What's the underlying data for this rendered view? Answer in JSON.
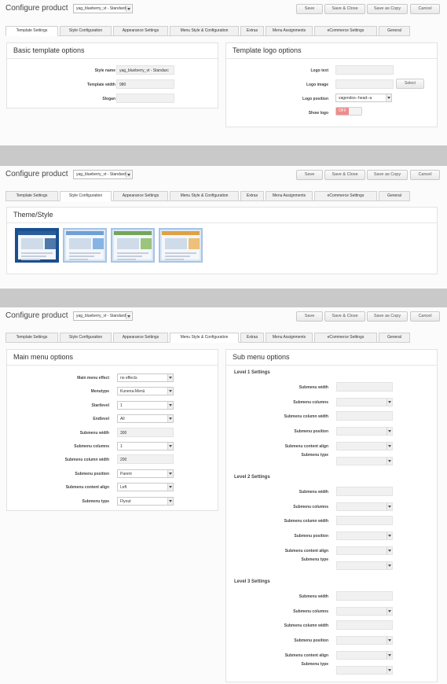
{
  "colors": {
    "separator": "#c9c9c9",
    "toggle_off": "#ef8c8c",
    "active_theme_border": "#1a4f8f"
  },
  "toolbar": {
    "title": "Configure product",
    "product_select": "yag_blueberry_vt - Standard",
    "save": "Save",
    "save_close": "Save & Close",
    "save_copy": "Save as Copy",
    "cancel": "Cancel"
  },
  "tabs": [
    "Template Settings",
    "Style Configuration",
    "Appearance Settings",
    "Menu Style & Configuration",
    "Extras",
    "Menu Assignments",
    "eCommerce Settings",
    "General"
  ],
  "panel1": {
    "basic": {
      "title": "Basic template options",
      "style_name_label": "Style name",
      "style_name_value": "yag_blueberry_vt - Standarc",
      "template_width_label": "Template width",
      "template_width_value": "980",
      "slogan_label": "Slogan"
    },
    "logo": {
      "title": "Template logo options",
      "logo_text_label": "Logo text",
      "logo_image_label": "Logo image",
      "select_button": "Select",
      "logo_position_label": "Logo position",
      "logo_position_value": "vagendos--head--a",
      "show_logo_label": "Show logo",
      "show_logo_value": "OFF"
    }
  },
  "panel2": {
    "title": "Theme/Style",
    "themes": [
      {
        "name": "theme-blue",
        "bar": "#2c5d9b",
        "accent": "#4f78ad"
      },
      {
        "name": "theme-sky",
        "bar": "#6e9fd6",
        "accent": "#86b4e4"
      },
      {
        "name": "theme-green",
        "bar": "#74a55a",
        "accent": "#9cc47d"
      },
      {
        "name": "theme-orange",
        "bar": "#e0a043",
        "accent": "#eec07a"
      }
    ]
  },
  "panel3": {
    "main": {
      "title": "Main menu options",
      "fields": [
        {
          "label": "Main menu effect",
          "value": "no effects",
          "kind": "select"
        },
        {
          "label": "Menutype",
          "value": "Kunena-Menü",
          "kind": "select"
        },
        {
          "label": "Startlevel",
          "value": "1",
          "kind": "select"
        },
        {
          "label": "Endlevel",
          "value": "All",
          "kind": "select"
        },
        {
          "label": "Submenu width",
          "value": "300",
          "kind": "input"
        },
        {
          "label": "Submenu columns",
          "value": "1",
          "kind": "select"
        },
        {
          "label": "Submenu column width",
          "value": "200",
          "kind": "input"
        },
        {
          "label": "Submenu position",
          "value": "Parent",
          "kind": "select"
        },
        {
          "label": "Submenu content align",
          "value": "Left",
          "kind": "select"
        },
        {
          "label": "Submenu type",
          "value": "Flyout",
          "kind": "select"
        }
      ]
    },
    "sub": {
      "title": "Sub menu options",
      "levels": [
        "Level 1 Settings",
        "Level 2 Settings",
        "Level 3 Settings"
      ],
      "field_labels": [
        "Submenu width",
        "Submenu columns",
        "Submenu column width",
        "Submenu position",
        "Submenu content align",
        "Submenu type"
      ]
    }
  }
}
